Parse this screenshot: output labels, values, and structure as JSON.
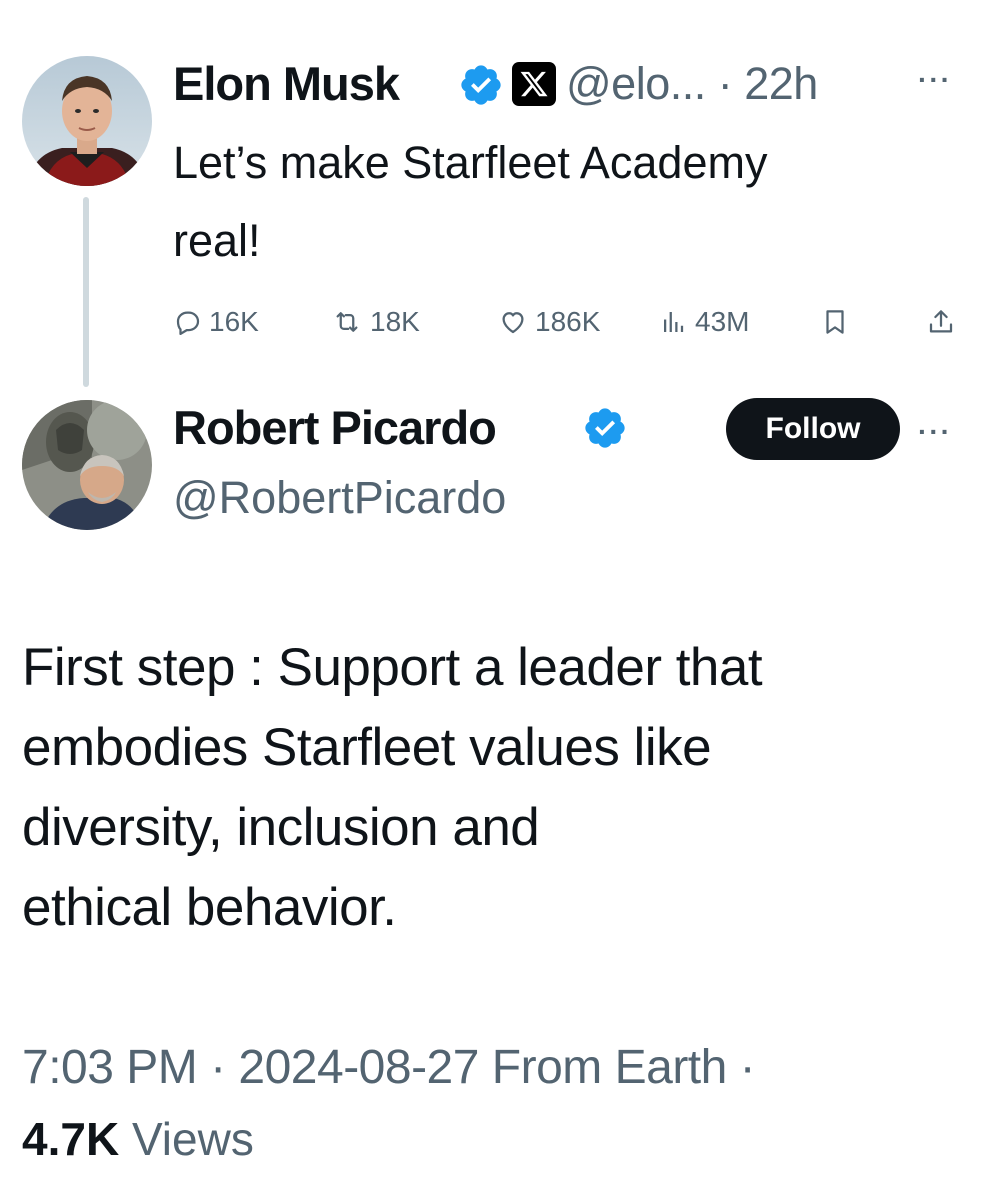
{
  "colors": {
    "text_primary": "#0f1419",
    "text_secondary": "#536471",
    "verified_blue": "#1d9bf0",
    "follow_button_bg": "#0f1419",
    "thread_line": "#cfd9de"
  },
  "parent_tweet": {
    "author_name": "Elon Musk",
    "verified_icon": "verified-badge-icon",
    "affiliate_icon": "x-logo-icon",
    "handle_time": "@elo... · 22h",
    "more_icon": "more-options-icon",
    "more_label": "···",
    "text_line_1": "Let’s make Starfleet Academy",
    "text_line_2": "real!",
    "actions": {
      "replies": "16K",
      "reposts": "18K",
      "likes": "186K",
      "views": "43M"
    }
  },
  "reply_tweet": {
    "author_name": "Robert Picardo",
    "verified_icon": "verified-badge-icon",
    "handle": "@RobertPicardo",
    "follow_label": "Follow",
    "more_label": "···",
    "text_lines": [
      "First step : Support a leader that",
      "embodies Starfleet values like",
      "diversity, inclusion and",
      "ethical behavior."
    ],
    "meta": "7:03 PM · 2024-08-27 From Earth ·",
    "views_count": "4.7K",
    "views_label": "Views"
  }
}
